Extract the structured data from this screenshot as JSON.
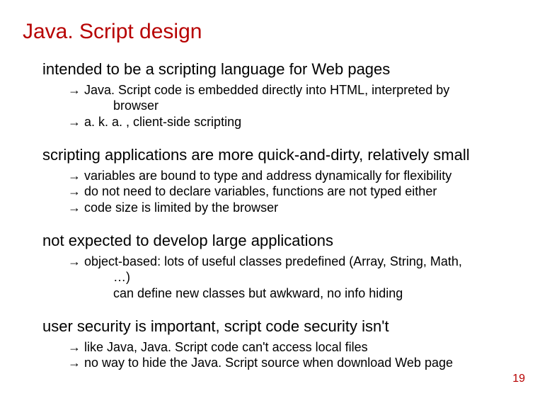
{
  "title": "Java. Script design",
  "sections": [
    {
      "heading": "intended to be a scripting language for Web pages",
      "bullets": [
        "→ Java. Script code is embedded directly into HTML, interpreted by",
        "→ a. k. a. , client-side scripting"
      ],
      "subs": [
        "browser"
      ],
      "sub_after": 0
    },
    {
      "heading": "scripting applications are more quick-and-dirty, relatively small",
      "bullets": [
        "→ variables are bound to type and address dynamically for flexibility",
        "→ do not need to declare variables, functions are not typed either",
        "→ code size is limited by the browser"
      ],
      "subs": [],
      "sub_after": -1
    },
    {
      "heading": "not expected to develop large applications",
      "bullets": [
        "→ object-based: lots of useful classes predefined (Array, String, Math,"
      ],
      "subs": [
        "…)",
        "can define new classes but awkward, no info hiding"
      ],
      "sub_after": 0
    },
    {
      "heading": "user security is important, script code security isn't",
      "bullets": [
        "→ like Java, Java. Script code can't access local files",
        "→ no way to hide the Java. Script source when download Web page"
      ],
      "subs": [],
      "sub_after": -1
    }
  ],
  "page_number": "19"
}
